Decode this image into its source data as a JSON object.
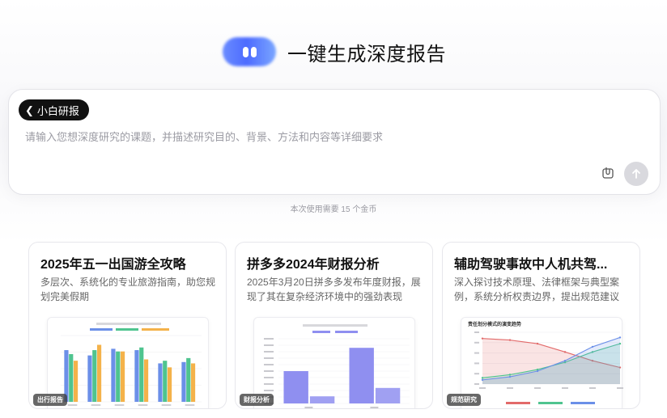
{
  "header": {
    "title": "一键生成深度报告"
  },
  "input": {
    "mode_label": "小白研报",
    "placeholder": "请输入您想深度研究的课题，并描述研究目的、背景、方法和内容等详细要求"
  },
  "cost_note": "本次使用需要 15 个金币",
  "cards": [
    {
      "title": "2025年五一出国游全攻略",
      "desc": "多层次、系统化的专业旅游指南，助您规划完美假期",
      "tag": "出行报告"
    },
    {
      "title": "拼多多2024年财报分析",
      "desc": "2025年3月20日拼多多发布年度财报，展现了其在复杂经济环境中的强劲表现",
      "tag": "财报分析"
    },
    {
      "title": "辅助驾驶事故中人机共驾...",
      "desc": "深入探讨技术原理、法律框架与典型案例，系统分析权责边界，提出规范建议",
      "tag": "规范研究",
      "chart_title": "责任划分模式的演变趋势"
    }
  ],
  "chart_data": [
    {
      "type": "bar",
      "categories": [
        "c1",
        "c2",
        "c3",
        "c4",
        "c5",
        "c6"
      ],
      "series": [
        {
          "values": [
            78,
            70,
            80,
            78,
            58,
            60
          ]
        },
        {
          "values": [
            72,
            78,
            76,
            82,
            62,
            66
          ]
        },
        {
          "values": [
            62,
            86,
            76,
            64,
            52,
            58
          ]
        }
      ],
      "ylim": [
        0,
        100
      ],
      "colors": [
        "#6b8fe8",
        "#4fc48f",
        "#f4b24a"
      ]
    },
    {
      "type": "bar",
      "categories": [
        "2023",
        "2024"
      ],
      "series": [
        {
          "values": [
            2500,
            4300
          ]
        },
        {
          "values": [
            550,
            1200
          ]
        }
      ],
      "ylim": [
        0,
        5000
      ],
      "colors": [
        "#8f8ff0",
        "#8f8ff0"
      ]
    },
    {
      "type": "line",
      "x": [
        "2016",
        "2017",
        "2018",
        "2019",
        "2020",
        "2021"
      ],
      "series": [
        {
          "values": [
            88,
            85,
            78,
            62,
            45,
            32
          ],
          "color": "#e26a6a"
        },
        {
          "values": [
            12,
            18,
            28,
            42,
            62,
            78
          ],
          "color": "#4fc48f"
        },
        {
          "values": [
            8,
            14,
            25,
            45,
            72,
            90
          ],
          "color": "#6b8fe8"
        }
      ],
      "ylim": [
        0,
        100
      ]
    }
  ]
}
